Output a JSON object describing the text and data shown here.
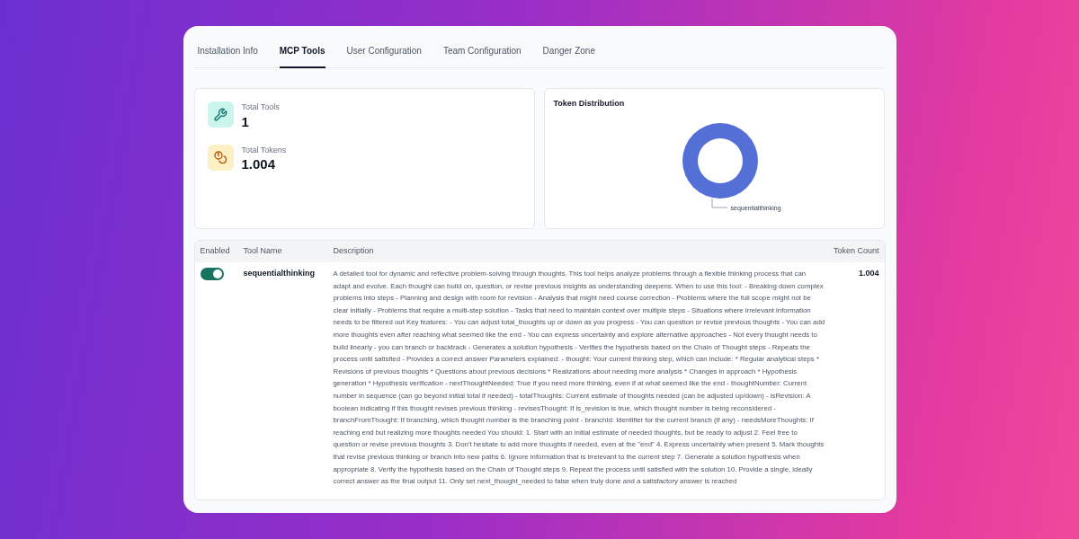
{
  "tabs": [
    {
      "label": "Installation Info",
      "selected": false
    },
    {
      "label": "MCP Tools",
      "selected": true
    },
    {
      "label": "User Configuration",
      "selected": false
    },
    {
      "label": "Team Configuration",
      "selected": false
    },
    {
      "label": "Danger Zone",
      "selected": false
    }
  ],
  "stats": [
    {
      "kind": "tools",
      "label": "Total Tools",
      "value": "1"
    },
    {
      "kind": "tokens",
      "label": "Total Tokens",
      "value": "1.004"
    }
  ],
  "token_distribution": {
    "title": "Token Distribution",
    "legend_labels": [
      "sequentialthinking"
    ]
  },
  "table": {
    "columns": [
      "Enabled",
      "Tool Name",
      "Description",
      "Token Count"
    ],
    "rows": [
      {
        "enabled": true,
        "name": "sequentialthinking",
        "description": "A detailed tool for dynamic and reflective problem-solving through thoughts. This tool helps analyze problems through a flexible thinking process that can adapt and evolve. Each thought can build on, question, or revise previous insights as understanding deepens. When to use this tool: - Breaking down complex problems into steps - Planning and design with room for revision - Analysis that might need course correction - Problems where the full scope might not be clear initially - Problems that require a multi-step solution - Tasks that need to maintain context over multiple steps - Situations where irrelevant information needs to be filtered out Key features: - You can adjust total_thoughts up or down as you progress - You can question or revise previous thoughts - You can add more thoughts even after reaching what seemed like the end - You can express uncertainty and explore alternative approaches - Not every thought needs to build linearly - you can branch or backtrack - Generates a solution hypothesis - Verifies the hypothesis based on the Chain of Thought steps - Repeats the process until satisfied - Provides a correct answer Parameters explained: - thought: Your current thinking step, which can include: * Regular analytical steps * Revisions of previous thoughts * Questions about previous decisions * Realizations about needing more analysis * Changes in approach * Hypothesis generation * Hypothesis verification - nextThoughtNeeded: True if you need more thinking, even if at what seemed like the end - thoughtNumber: Current number in sequence (can go beyond initial total if needed) - totalThoughts: Current estimate of thoughts needed (can be adjusted up/down) - isRevision: A boolean indicating if this thought revises previous thinking - revisesThought: If is_revision is true, which thought number is being reconsidered - branchFromThought: If branching, which thought number is the branching point - branchId: Identifier for the current branch (if any) - needsMoreThoughts: If reaching end but realizing more thoughts needed You should: 1. Start with an initial estimate of needed thoughts, but be ready to adjust 2. Feel free to question or revise previous thoughts 3. Don't hesitate to add more thoughts if needed, even at the \"end\" 4. Express uncertainty when present 5. Mark thoughts that revise previous thinking or branch into new paths 6. Ignore information that is irrelevant to the current step 7. Generate a solution hypothesis when appropriate 8. Verify the hypothesis based on the Chain of Thought steps 9. Repeat the process until satisfied with the solution 10. Provide a single, ideally correct answer as the final output 11. Only set next_thought_needed to false when truly done and a satisfactory answer is reached",
        "tokens": "1.004"
      }
    ]
  }
}
